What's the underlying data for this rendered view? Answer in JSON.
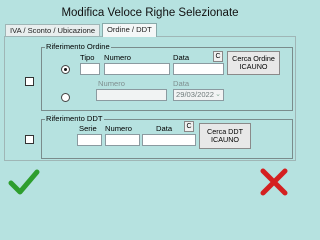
{
  "window": {
    "title": "Modifica Veloce Righe Selezionate"
  },
  "tabs": [
    {
      "label": "IVA / Sconto / Ubicazione",
      "active": false
    },
    {
      "label": "Ordine / DDT",
      "active": true
    }
  ],
  "order_ref": {
    "legend": "Riferimento Ordine",
    "checked": false,
    "labels": {
      "tipo": "Tipo",
      "numero": "Numero",
      "data": "Data"
    },
    "row1": {
      "selected": true,
      "tipo": "",
      "numero": "",
      "data": ""
    },
    "row2": {
      "selected": false,
      "numero_label": "Numero",
      "data_label": "Data",
      "numero": "",
      "data": "29/03/2022"
    },
    "c_button": "C",
    "search_button": [
      "Cerca Ordine",
      "ICAUNO"
    ]
  },
  "ddt_ref": {
    "legend": "Riferimento DDT",
    "checked": false,
    "labels": {
      "serie": "Serie",
      "numero": "Numero",
      "data": "Data"
    },
    "serie": "",
    "numero": "",
    "data": "",
    "c_button": "C",
    "search_button": [
      "Cerca DDT",
      "ICAUNO"
    ]
  },
  "actions": {
    "confirm_icon": "check-icon",
    "cancel_icon": "close-icon",
    "confirm_color": "#2e9e2e",
    "cancel_color": "#d42020"
  }
}
